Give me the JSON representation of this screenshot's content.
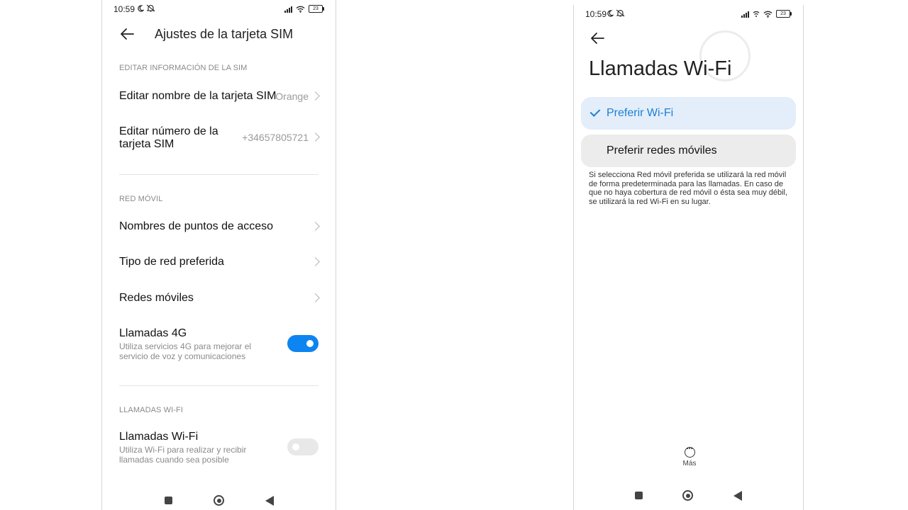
{
  "left_screen": {
    "status": {
      "time": "10:59",
      "battery": "23"
    },
    "title": "Ajustes de la tarjeta SIM",
    "sections": {
      "sim_info": "EDITAR INFORMACIÓN DE LA SIM",
      "mobile_network": "RED MÓVIL",
      "wifi_calls": "LLAMADAS WI-FI"
    },
    "rows": {
      "edit_name": {
        "label": "Editar nombre de la tarjeta SIM",
        "value": "Orange"
      },
      "edit_number": {
        "label": "Editar número de la tarjeta SIM",
        "value": "+34657805721"
      },
      "apn": {
        "label": "Nombres de puntos de acceso"
      },
      "preferred_network": {
        "label": "Tipo de red preferida"
      },
      "mobile_networks": {
        "label": "Redes móviles"
      },
      "calls_4g": {
        "label": "Llamadas 4G",
        "description": "Utiliza servicios 4G para mejorar el servicio de voz y comunicaciones",
        "enabled": true
      },
      "wifi_calling": {
        "label": "Llamadas Wi-Fi",
        "description": "Utiliza Wi-Fi para realizar y recibir llamadas cuando sea posible",
        "enabled": false
      }
    }
  },
  "right_screen": {
    "status": {
      "time": "10:59",
      "battery": "23"
    },
    "title": "Llamadas Wi-Fi",
    "options": [
      {
        "label": "Preferir Wi-Fi",
        "selected": true
      },
      {
        "label": "Preferir redes móviles",
        "selected": false
      }
    ],
    "description": "Si selecciona Red móvil preferida se utilizará la red móvil de forma predeterminada para las llamadas. En caso de que no haya cobertura de red móvil o ésta sea muy débil, se utilizará la red Wi-Fi en su lugar.",
    "more_label": "Más"
  },
  "colors": {
    "accent": "#0d84f0",
    "selected_bg": "#e3eefa",
    "selected_text": "#1b7fd6"
  }
}
